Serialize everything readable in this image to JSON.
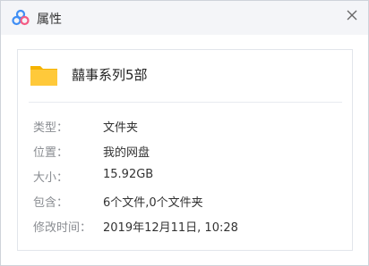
{
  "window": {
    "title": "属性",
    "app_icon": "baidu-netdisk-cloud-icon",
    "close_icon": "close-icon"
  },
  "file": {
    "name": "囍事系列5部",
    "icon": "folder-icon",
    "icon_color": "#ffc93a"
  },
  "properties": [
    {
      "label": "类型：",
      "value": "文件夹"
    },
    {
      "label": "位置：",
      "value": "我的网盘"
    },
    {
      "label": "大小：",
      "value": "15.92GB"
    },
    {
      "label": "包含：",
      "value": "6个文件,0个文件夹"
    },
    {
      "label": "修改时间：",
      "value": "2019年12月11日, 10:28"
    }
  ],
  "colors": {
    "titlebar_bg": "#f4f5f8",
    "label_text": "#8a8d92",
    "value_text": "#333333",
    "logo_blue": "#3f8ef5",
    "logo_pink": "#f45b84"
  }
}
